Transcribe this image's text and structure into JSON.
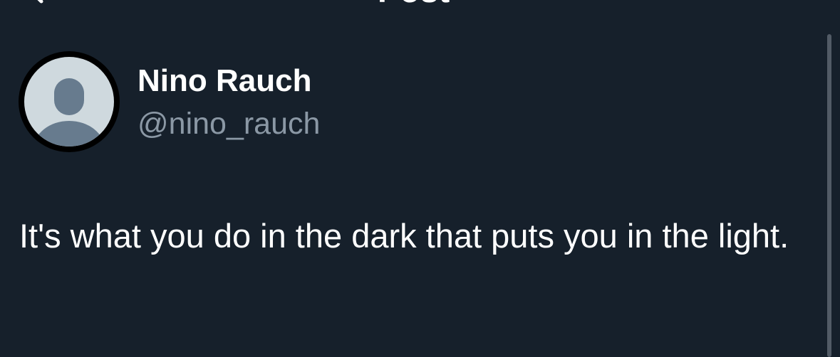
{
  "header": {
    "title": "Post"
  },
  "author": {
    "display_name": "Nino Rauch",
    "handle": "@nino_rauch",
    "avatar_icon": "default-profile-icon"
  },
  "post": {
    "text": "It's what you do in the dark that puts you in the light."
  },
  "colors": {
    "background": "#16202b",
    "text_primary": "#ffffff",
    "text_secondary": "#8b98a5",
    "avatar_fill": "#cfd9de",
    "avatar_silhouette": "#677b8e"
  }
}
